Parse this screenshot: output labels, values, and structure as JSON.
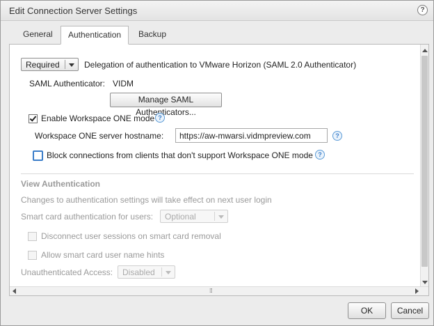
{
  "window": {
    "title": "Edit Connection Server Settings"
  },
  "tabs": [
    {
      "label": "General",
      "active": false
    },
    {
      "label": "Authentication",
      "active": true
    },
    {
      "label": "Backup",
      "active": false
    }
  ],
  "saml": {
    "delegation_value": "Required",
    "delegation_label": "Delegation of authentication to VMware Horizon (SAML 2.0 Authenticator)",
    "authenticator_label": "SAML Authenticator:",
    "authenticator_value": "VIDM",
    "manage_button": "Manage SAML Authenticators..."
  },
  "workspace": {
    "enable_label": "Enable Workspace ONE mode",
    "enable_checked": true,
    "hostname_label": "Workspace ONE server hostname:",
    "hostname_value": "https://aw-mwarsi.vidmpreview.com",
    "block_label": "Block connections from clients that don't support Workspace ONE mode",
    "block_checked": false
  },
  "view_auth": {
    "heading": "View Authentication",
    "note": "Changes to authentication settings will take effect on next user login",
    "smartcard_label": "Smart card authentication for users:",
    "smartcard_value": "Optional",
    "disconnect_label": "Disconnect user sessions on smart card removal",
    "hints_label": "Allow smart card user name hints",
    "unauth_label": "Unauthenticated Access:",
    "unauth_value": "Disabled"
  },
  "footer": {
    "ok": "OK",
    "cancel": "Cancel"
  },
  "colors": {
    "accent": "#3a7dc9",
    "disabled_text": "#9a9a9a",
    "dialog_bg": "#ececec"
  },
  "icons": [
    "help-icon",
    "info-icon",
    "chevron-down-icon",
    "checkmark-icon"
  ]
}
